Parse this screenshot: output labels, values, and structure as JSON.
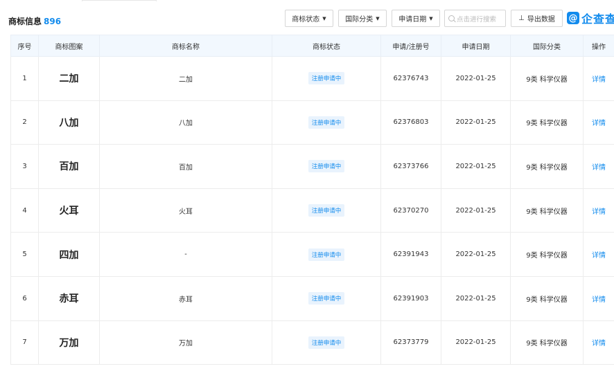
{
  "header": {
    "title": "商标信息",
    "count": "896",
    "filters": {
      "status": "商标状态",
      "intl_class": "国际分类",
      "apply_date": "申请日期"
    },
    "search_placeholder": "点击进行搜索",
    "export_label": "导出数据",
    "logo_mark": "@",
    "logo_text": "企查查"
  },
  "table": {
    "columns": [
      "序号",
      "商标图案",
      "商标名称",
      "商标状态",
      "申请/注册号",
      "申请日期",
      "国际分类",
      "操作"
    ],
    "rows": [
      {
        "index": "1",
        "pattern": "二加",
        "name": "二加",
        "status": "注册申请中",
        "reg_no": "62376743",
        "date": "2022-01-25",
        "class": "9类 科学仪器",
        "action": "详情"
      },
      {
        "index": "2",
        "pattern": "八加",
        "name": "八加",
        "status": "注册申请中",
        "reg_no": "62376803",
        "date": "2022-01-25",
        "class": "9类 科学仪器",
        "action": "详情"
      },
      {
        "index": "3",
        "pattern": "百加",
        "name": "百加",
        "status": "注册申请中",
        "reg_no": "62373766",
        "date": "2022-01-25",
        "class": "9类 科学仪器",
        "action": "详情"
      },
      {
        "index": "4",
        "pattern": "火耳",
        "name": "火耳",
        "status": "注册申请中",
        "reg_no": "62370270",
        "date": "2022-01-25",
        "class": "9类 科学仪器",
        "action": "详情"
      },
      {
        "index": "5",
        "pattern": "四加",
        "name": "-",
        "status": "注册申请中",
        "reg_no": "62391943",
        "date": "2022-01-25",
        "class": "9类 科学仪器",
        "action": "详情"
      },
      {
        "index": "6",
        "pattern": "赤耳",
        "name": "赤耳",
        "status": "注册申请中",
        "reg_no": "62391903",
        "date": "2022-01-25",
        "class": "9类 科学仪器",
        "action": "详情"
      },
      {
        "index": "7",
        "pattern": "万加",
        "name": "万加",
        "status": "注册申请中",
        "reg_no": "62373779",
        "date": "2022-01-25",
        "class": "9类 科学仪器",
        "action": "详情"
      }
    ]
  },
  "colors": {
    "accent": "#128bed",
    "header_bg": "#f2f8fe",
    "tag_bg": "#e9f3fd"
  }
}
